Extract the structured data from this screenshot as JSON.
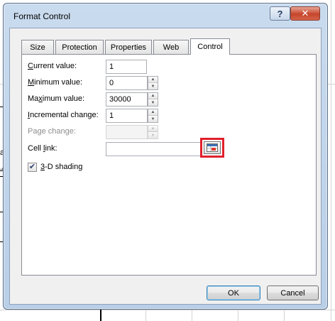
{
  "window": {
    "title": "Format Control",
    "help_glyph": "?",
    "close_glyph": "✕"
  },
  "tabs": [
    {
      "label": "Size",
      "active": false
    },
    {
      "label": "Protection",
      "active": false
    },
    {
      "label": "Properties",
      "active": false
    },
    {
      "label": "Web",
      "active": false
    },
    {
      "label": "Control",
      "active": true
    }
  ],
  "fields": {
    "current_value": {
      "mnemonic": "C",
      "label_rest": "urrent value:",
      "value": "1"
    },
    "minimum_value": {
      "mnemonic": "M",
      "label_rest": "inimum value:",
      "value": "0"
    },
    "maximum_value": {
      "label_pre": "Ma",
      "mnemonic": "x",
      "label_rest": "imum value:",
      "value": "30000"
    },
    "incremental_change": {
      "mnemonic": "I",
      "label_rest": "ncremental change:",
      "value": "1"
    },
    "page_change": {
      "label": "Page change:",
      "value": "",
      "disabled": true
    },
    "cell_link": {
      "label_pre": "Cell ",
      "mnemonic": "l",
      "label_rest": "ink:",
      "value": ""
    }
  },
  "shading": {
    "mnemonic": "3",
    "label_rest": "-D shading",
    "checked": true,
    "check_glyph": "✔"
  },
  "spin_glyphs": {
    "up": "▲",
    "down": "▼"
  },
  "buttons": {
    "ok": "OK",
    "cancel": "Cancel"
  },
  "background": {
    "text_1": "ay",
    "text_2": "./"
  },
  "colors": {
    "highlight": "#e0202b",
    "title_bar": "#c9dbee",
    "close_button": "#c6452c"
  }
}
